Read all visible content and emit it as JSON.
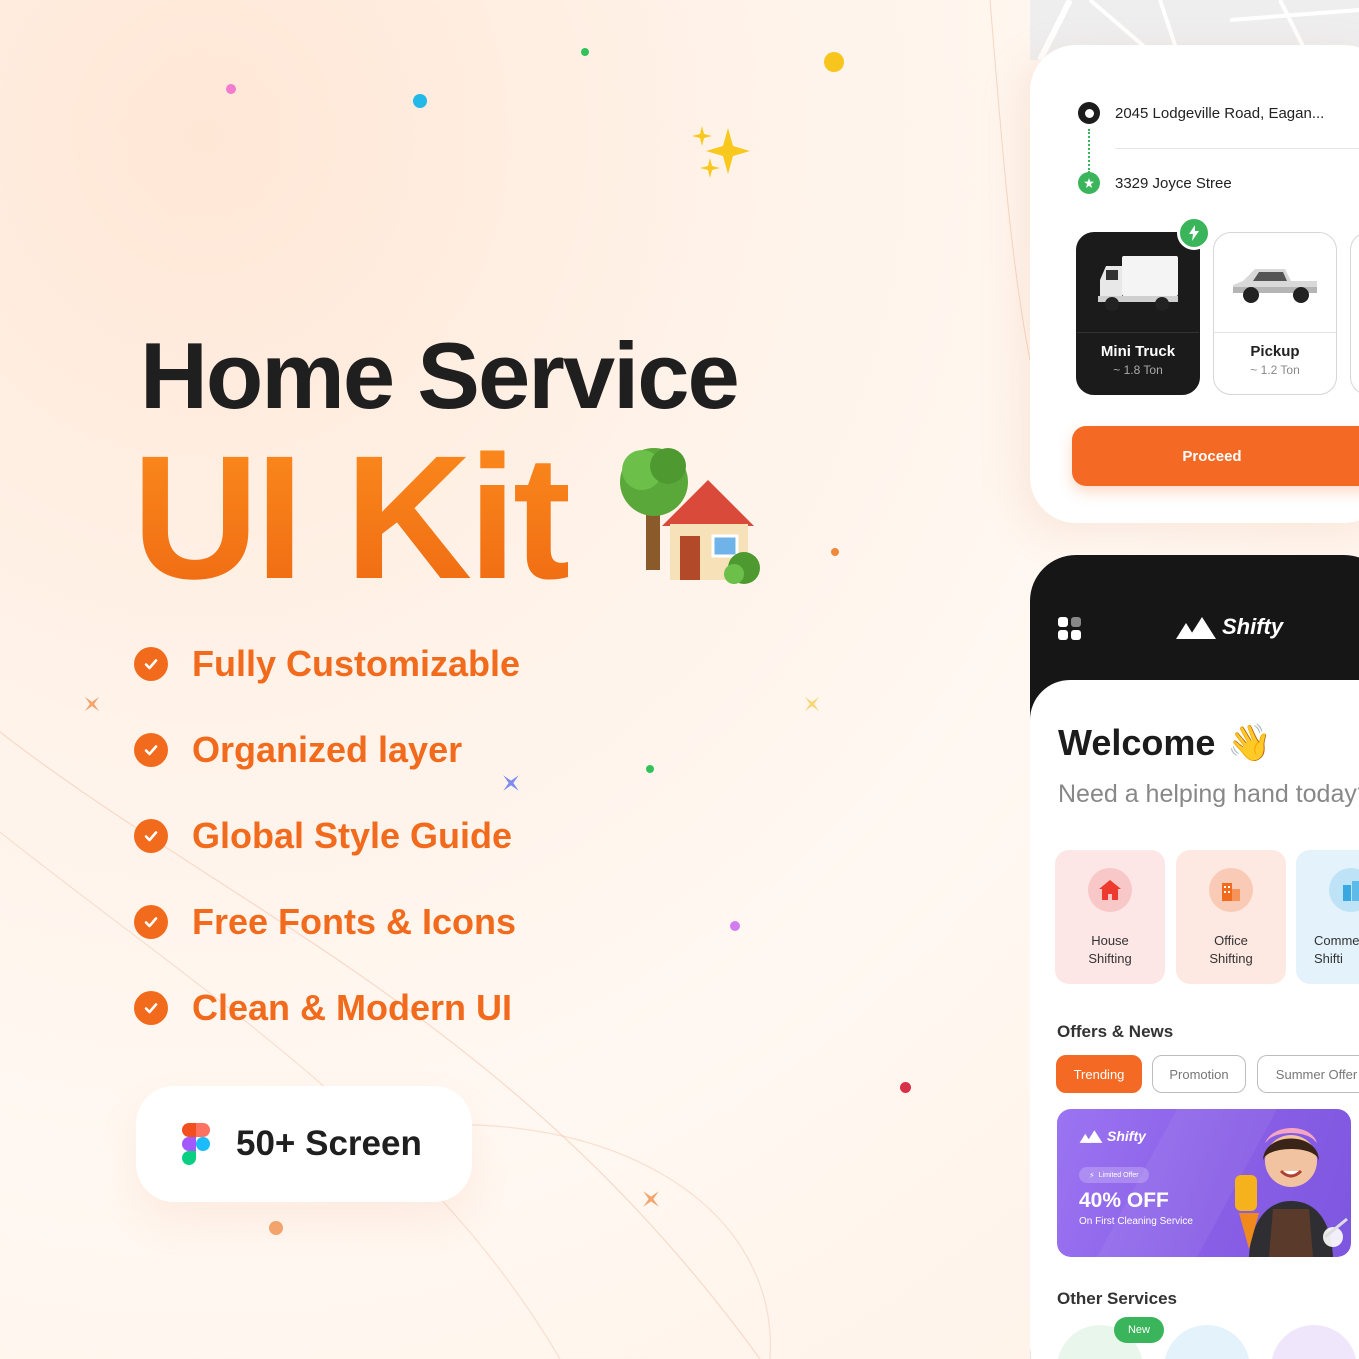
{
  "hero": {
    "title_line1": "Home Service",
    "title_line2": "UI Kit"
  },
  "features": [
    "Fully Customizable",
    "Organized layer",
    "Global Style Guide",
    "Free Fonts & Icons",
    "Clean & Modern UI"
  ],
  "badge": {
    "label": "50+ Screen",
    "icon": "figma-icon"
  },
  "booking": {
    "pickup_address": "2045  Lodgeville Road, Eagan...",
    "drop_address": "3329  Joyce Stree",
    "vehicles": [
      {
        "name": "Mini Truck",
        "capacity": "~ 1.8 Ton",
        "selected": true
      },
      {
        "name": "Pickup",
        "capacity": "~ 1.2 Ton",
        "selected": false
      }
    ],
    "proceed_label": "Proceed"
  },
  "home": {
    "brand": "Shifty",
    "welcome": "Welcome",
    "welcome_emoji": "👋",
    "subtitle": "Need a helping hand today?",
    "services": [
      {
        "label": "House\nShifting",
        "icon": "house-icon",
        "bg": "#fde8e8"
      },
      {
        "label": "Office\nShifting",
        "icon": "office-icon",
        "bg": "#fdebe2"
      },
      {
        "label": "Comme\nShifti",
        "icon": "commercial-icon",
        "bg": "#e6f3fb"
      }
    ],
    "offers_title": "Offers & News",
    "chips": [
      "Trending",
      "Promotion",
      "Summer Offer"
    ],
    "promo": {
      "brand": "Shifty",
      "tag": "Limited Offer",
      "headline": "40% OFF",
      "subline": "On First Cleaning Service"
    },
    "other_services_title": "Other Services",
    "new_badge": "New"
  },
  "colors": {
    "accent": "#f26b1d",
    "dark": "#161616",
    "green": "#3bb55b",
    "promo_purple": "#8a5fe6"
  }
}
